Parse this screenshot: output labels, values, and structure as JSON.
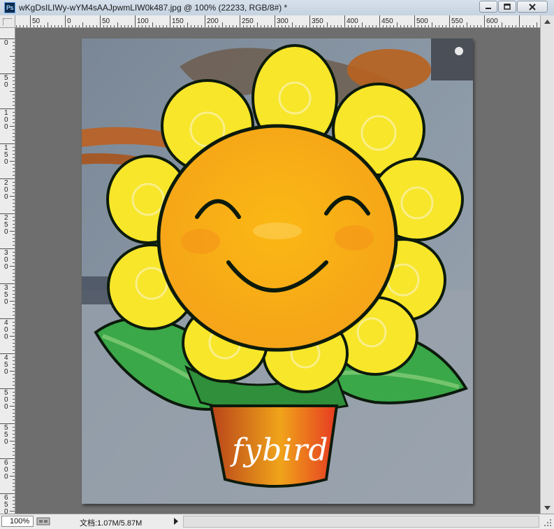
{
  "window": {
    "app_icon_label": "Ps",
    "title": "wKgDsILIWy-wYM4sAAJpwmLIW0k487.jpg @ 100% (22233, RGB/8#) *",
    "buttons": [
      "minimize",
      "maximize",
      "close"
    ]
  },
  "ruler_top": {
    "labels": [
      "100",
      "50",
      "0",
      "50",
      "100",
      "150",
      "200",
      "250",
      "300",
      "350",
      "400",
      "450",
      "500",
      "550",
      "600"
    ]
  },
  "ruler_left": {
    "labels": [
      "0",
      "5\n0",
      "1\n0\n0",
      "1\n5\n0",
      "2\n0\n0",
      "2\n5\n0",
      "3\n0\n0",
      "3\n5\n0",
      "4\n0\n0",
      "4\n5\n0",
      "5\n0\n0",
      "5\n5\n0",
      "6\n0\n0",
      "6\n5\n0"
    ]
  },
  "canvas": {
    "watermark_text": "fybird",
    "colors": {
      "workspace": "#6e6e6e",
      "petal": "#f7e62a",
      "face": "#fbb314",
      "leaf": "#3aa848",
      "pot": "#e2641c"
    }
  },
  "status": {
    "zoom": "100%",
    "doc_info": "文档:1.07M/5.87M"
  }
}
